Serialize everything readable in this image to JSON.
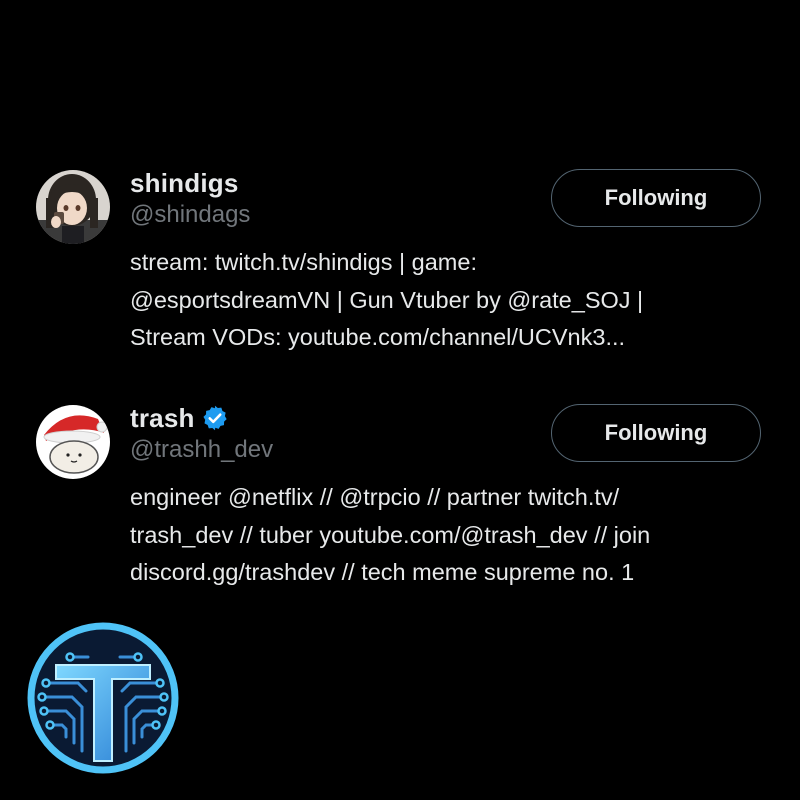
{
  "users": [
    {
      "display_name": "shindigs",
      "handle": "@shindags",
      "verified": false,
      "follow_label": "Following",
      "bio": "stream: twitch.tv/shindigs | game:\n@esportsdreamVN | Gun Vtuber by @rate_SOJ |\nStream VODs: youtube.com/channel/UCVnk3...",
      "avatar_icon": "anime-character-avatar"
    },
    {
      "display_name": "trash",
      "handle": "@trashh_dev",
      "verified": true,
      "verified_color": "#1d9bf0",
      "follow_label": "Following",
      "bio": "engineer @netflix // @trpcio // partner twitch.tv/\ntrash_dev // tuber youtube.com/@trash_dev // join\ndiscord.gg/trashdev // tech meme supreme no. 1",
      "avatar_icon": "santa-hat-blob-avatar"
    }
  ],
  "watermark": {
    "icon": "circuit-t-logo",
    "accent_color": "#4fc3f7"
  }
}
